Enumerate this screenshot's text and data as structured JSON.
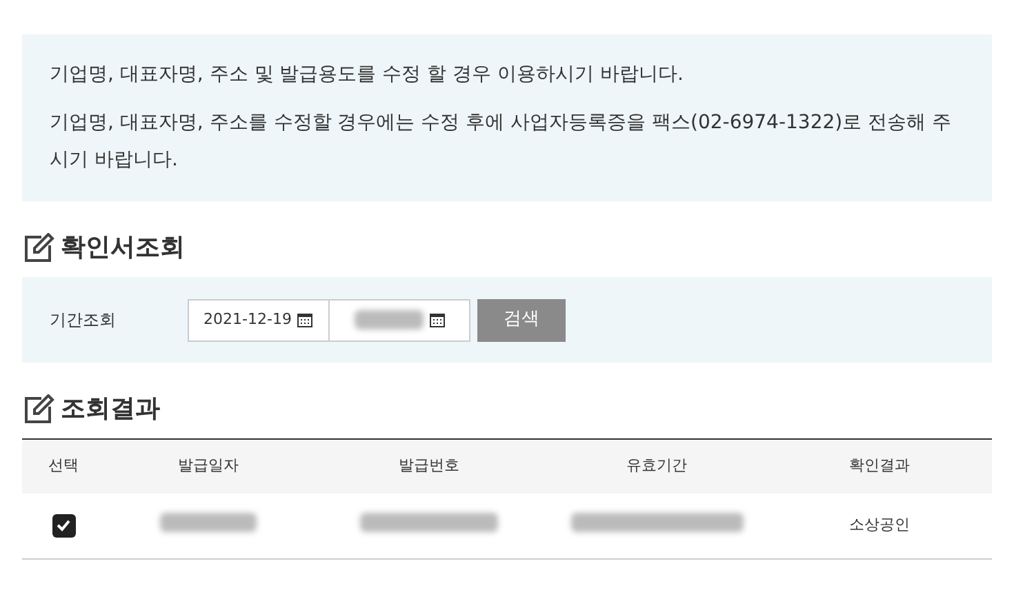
{
  "notice": {
    "lines": [
      "기업명, 대표자명, 주소 및 발급용도를 수정 할 경우 이용하시기 바랍니다.",
      "기업명, 대표자명, 주소를 수정할 경우에는 수정 후에 사업자등록증을 팩스(02-6974-1322)로 전송해 주시기 바랍니다."
    ]
  },
  "search_section": {
    "title": "확인서조회",
    "label": "기간조회",
    "start_date": {
      "kind": "text",
      "value": "2021-12-19"
    },
    "end_date": {
      "kind": "redacted"
    },
    "button": "검색"
  },
  "result_section": {
    "title": "조회결과",
    "columns": [
      "선택",
      "발급일자",
      "발급번호",
      "유효기간",
      "확인결과"
    ],
    "rows": [
      {
        "cells": [
          {
            "kind": "checkbox",
            "checked": true
          },
          {
            "kind": "redacted"
          },
          {
            "kind": "redacted"
          },
          {
            "kind": "redacted"
          },
          {
            "kind": "text",
            "text": "소상공인"
          }
        ]
      }
    ]
  }
}
